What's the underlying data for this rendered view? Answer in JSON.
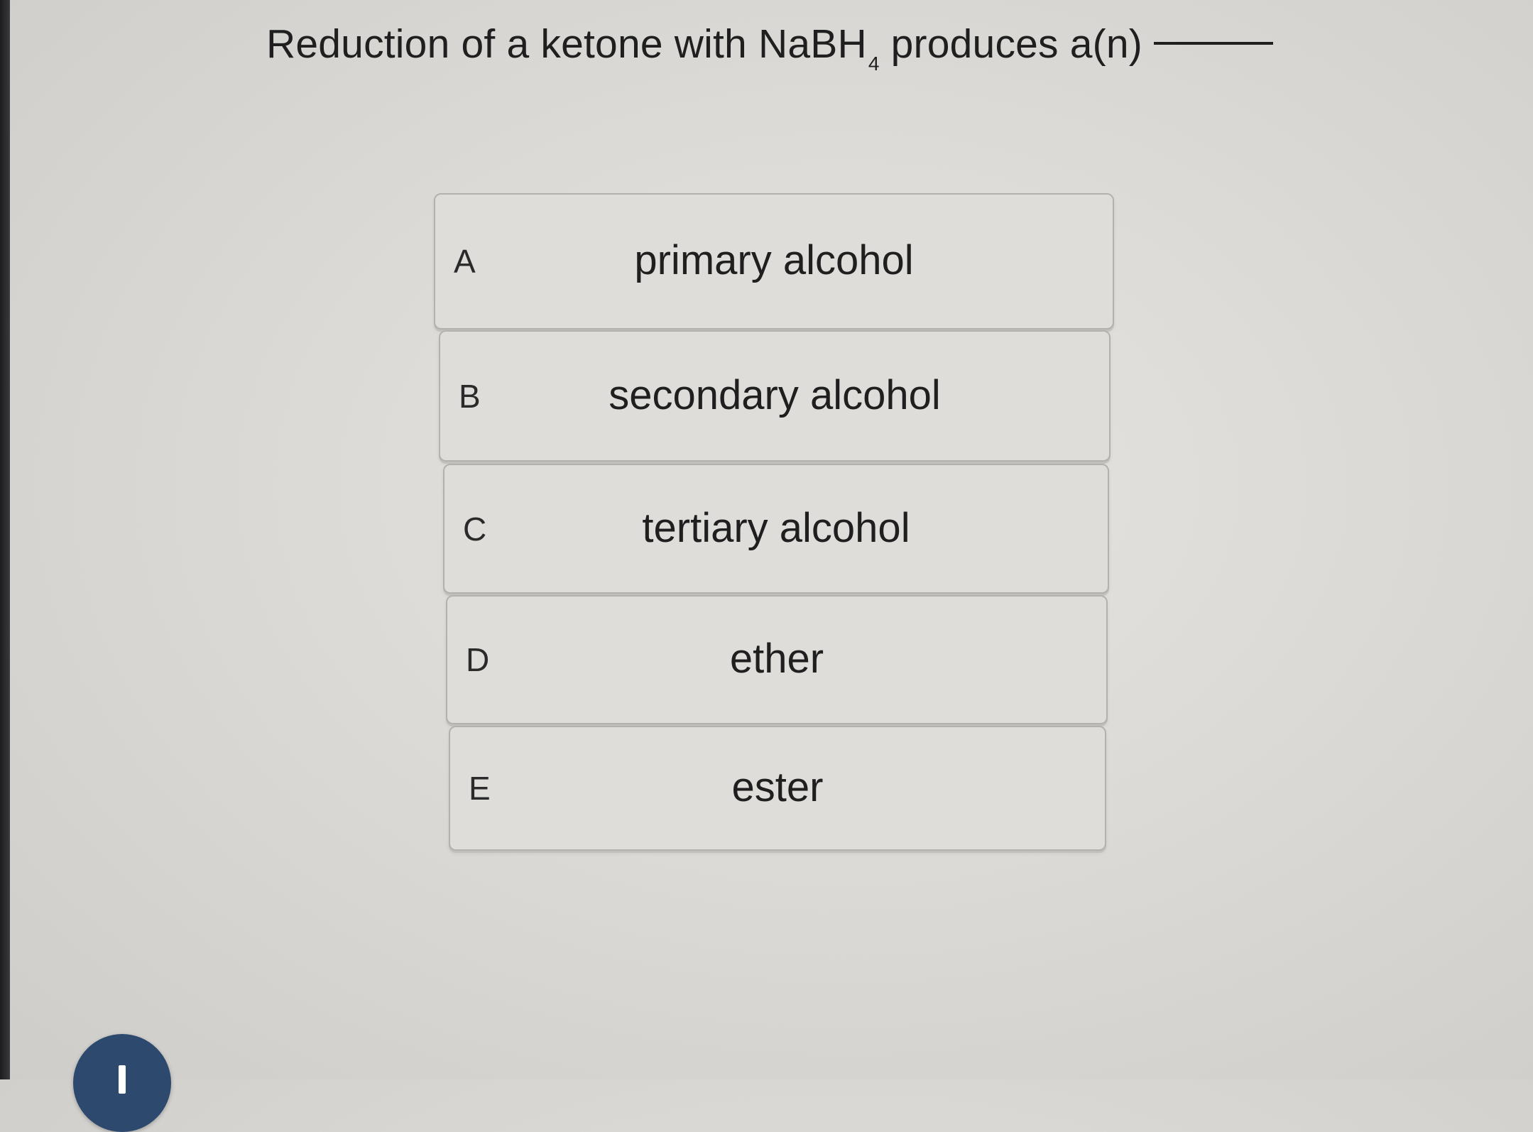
{
  "question": {
    "prefix": "Reduction of a ketone with NaBH",
    "subscript": "4",
    "suffix": " produces a(n)"
  },
  "choices": [
    {
      "letter": "A",
      "text": "primary alcohol"
    },
    {
      "letter": "B",
      "text": "secondary alcohol"
    },
    {
      "letter": "C",
      "text": "tertiary alcohol"
    },
    {
      "letter": "D",
      "text": "ether"
    },
    {
      "letter": "E",
      "text": "ester"
    }
  ],
  "colors": {
    "fab": "#2d4a6e",
    "card_background": "#dfddda",
    "card_border": "#b3b1ad"
  },
  "icons": {
    "fab": "plus-icon"
  }
}
